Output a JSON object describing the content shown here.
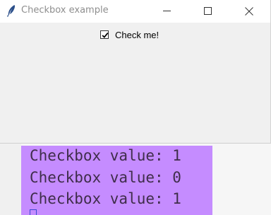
{
  "window": {
    "title": "Checkbox example",
    "icon": "feather-icon",
    "controls": [
      "minimize-icon",
      "maximize-icon",
      "close-icon"
    ]
  },
  "checkbox": {
    "label": "Check me!",
    "checked": true
  },
  "console": {
    "lines": [
      "Checkbox value: 1",
      "Checkbox value: 0",
      "Checkbox value: 1"
    ],
    "highlight_color": "#c58cff"
  }
}
